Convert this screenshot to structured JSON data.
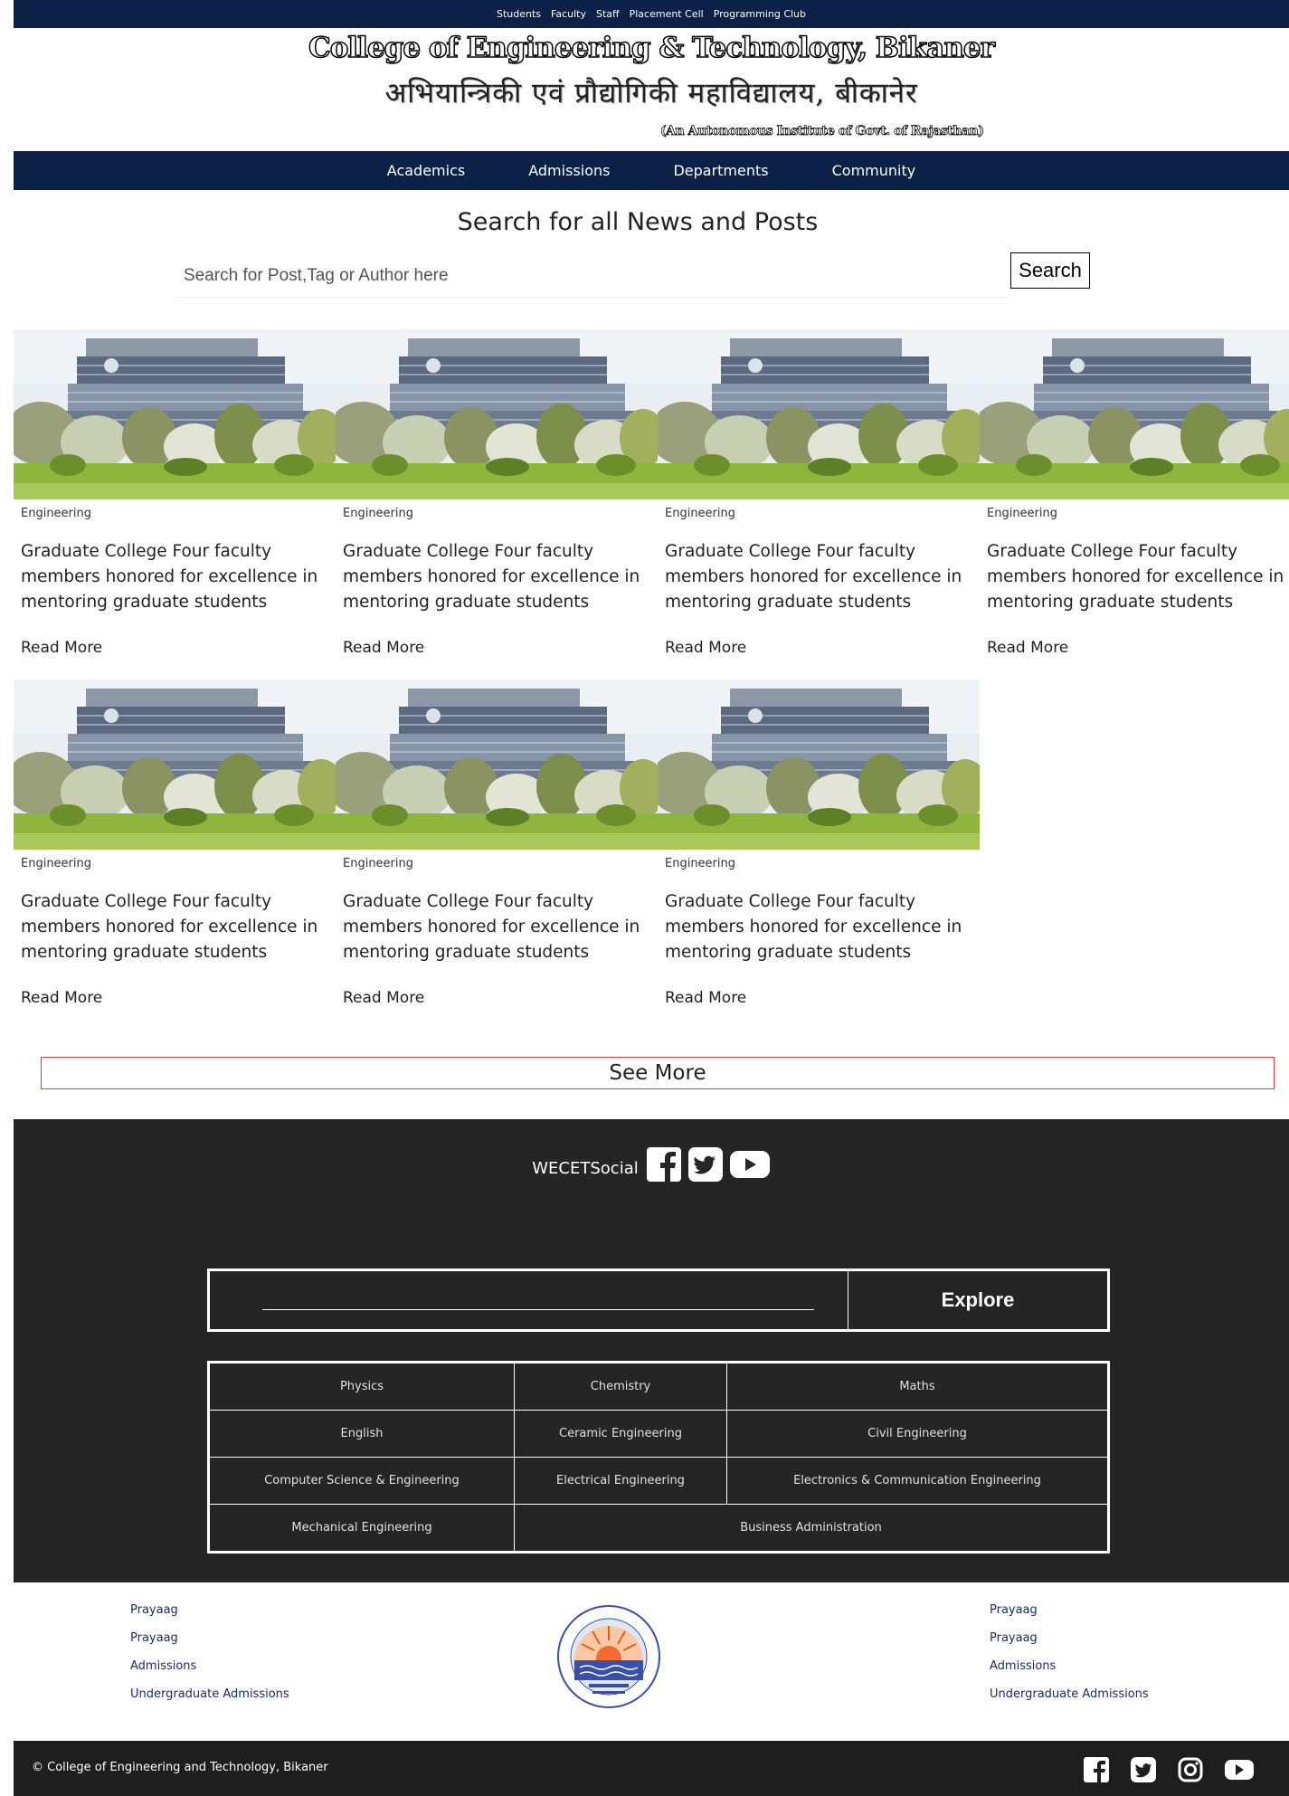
{
  "topnav": [
    "Students",
    "Faculty",
    "Staff",
    "Placement Cell",
    "Programming Club"
  ],
  "header": {
    "title_en": "College of Engineering & Technology, Bikaner",
    "title_hi": "अभियान्त्रिकी एवं प्रौद्योगिकी महाविद्यालय, बीकानेर",
    "subtitle": "(An Autonomous Institute of Govt. of Rajasthan)"
  },
  "mainnav": [
    "Academics",
    "Admissions",
    "Departments",
    "Community"
  ],
  "search": {
    "heading": "Search for all News and Posts",
    "placeholder": "Search for Post,Tag or Author here",
    "button": "Search"
  },
  "posts": [
    {
      "category": "Engineering",
      "title": "Graduate College Four faculty members honored for excellence in mentoring graduate students",
      "read_more": "Read More"
    },
    {
      "category": "Engineering",
      "title": "Graduate College Four faculty members honored for excellence in mentoring graduate students",
      "read_more": "Read More"
    },
    {
      "category": "Engineering",
      "title": "Graduate College Four faculty members honored for excellence in mentoring graduate students",
      "read_more": "Read More"
    },
    {
      "category": "Engineering",
      "title": "Graduate College Four faculty members honored for excellence in mentoring graduate students",
      "read_more": "Read More"
    },
    {
      "category": "Engineering",
      "title": "Graduate College Four faculty members honored for excellence in mentoring graduate students",
      "read_more": "Read More"
    },
    {
      "category": "Engineering",
      "title": "Graduate College Four faculty members honored for excellence in mentoring graduate students",
      "read_more": "Read More"
    },
    {
      "category": "Engineering",
      "title": "Graduate College Four faculty members honored for excellence in mentoring graduate students",
      "read_more": "Read More"
    }
  ],
  "see_more": "See More",
  "footer": {
    "social_label": "WECETSocial",
    "social_icons": [
      "facebook-icon",
      "twitter-icon",
      "youtube-icon"
    ],
    "explore_button": "Explore",
    "departments": [
      [
        "Physics",
        "Chemistry",
        "Maths"
      ],
      [
        "English",
        "Ceramic Engineering",
        "Civil Engineering"
      ],
      [
        "Computer Science & Engineering",
        "Electrical Engineering",
        "Electronics & Communication Engineering"
      ],
      [
        "Mechanical Engineering",
        "Business Administration"
      ]
    ]
  },
  "links_left": [
    "Prayaag",
    "Prayaag",
    "Admissions",
    "Undergraduate Admissions"
  ],
  "links_right": [
    "Prayaag",
    "Prayaag",
    "Admissions",
    "Undergraduate Admissions"
  ],
  "copyright": "© College of Engineering and Technology, Bikaner",
  "bottom_icons": [
    "facebook-icon",
    "twitter-icon",
    "instagram-icon",
    "youtube-icon"
  ],
  "colors": {
    "navy": "#0b2147",
    "footer_dark": "#252525",
    "bottom_bar": "#1e1e1e",
    "see_more_border": "#e03a3a"
  }
}
